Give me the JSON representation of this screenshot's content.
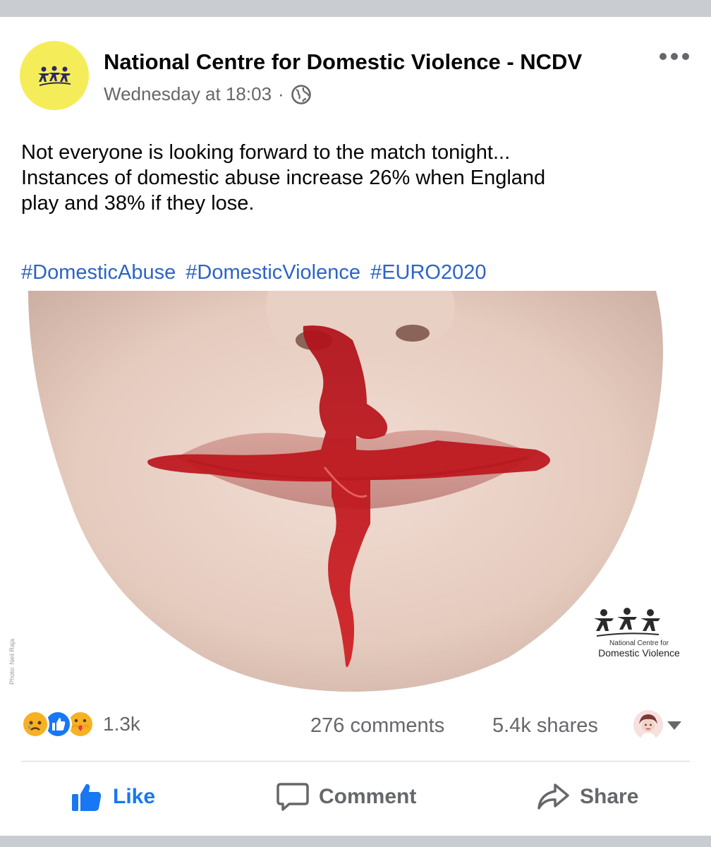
{
  "post": {
    "page_name": "National Centre for Domestic Violence - NCDV",
    "timestamp": "Wednesday at 18:03",
    "separator": "·",
    "text_lines": [
      "Not everyone is looking forward to the match tonight...",
      "Instances of domestic abuse increase 26% when England",
      "play and 38% if they lose."
    ],
    "hashtags": [
      "#DomesticAbuse",
      "#DomesticViolence",
      "#EURO2020"
    ],
    "image": {
      "watermark_small": "National Centre for",
      "watermark_big": "Domestic Violence",
      "photo_credit": "Photo: Neil Raja"
    }
  },
  "stats": {
    "reactions": [
      "sad",
      "like",
      "care"
    ],
    "reaction_count": "1.3k",
    "comments": "276 comments",
    "shares": "5.4k shares"
  },
  "actions": {
    "like": "Like",
    "comment": "Comment",
    "share": "Share"
  },
  "colors": {
    "brand_yellow": "#f5ec5a",
    "link_blue": "#2c64c6",
    "like_blue": "#1877f2",
    "meta_gray": "#65676b"
  },
  "icons": [
    "globe-icon",
    "more-icon",
    "like-thumb-icon",
    "comment-bubble-icon",
    "share-arrow-icon",
    "caret-down-icon"
  ]
}
